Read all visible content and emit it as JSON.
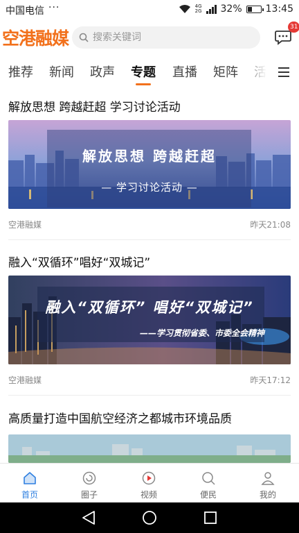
{
  "status_bar": {
    "carrier": "中国电信",
    "dots": "···",
    "network_top": "4G",
    "network_bottom": "2G",
    "battery_percent": "32%",
    "battery_level": 0.32,
    "time": "13:45"
  },
  "header": {
    "logo": "空港融媒",
    "search_placeholder": "搜索关键词",
    "message_badge": "31"
  },
  "tabs": {
    "items": [
      {
        "label": "推荐"
      },
      {
        "label": "新闻"
      },
      {
        "label": "政声"
      },
      {
        "label": "专题"
      },
      {
        "label": "直播"
      },
      {
        "label": "矩阵"
      },
      {
        "label": "活"
      }
    ],
    "active_index": 3
  },
  "articles": [
    {
      "title": "解放思想 跨越赶超 学习讨论活动",
      "banner_line1": "解放思想    跨越赶超",
      "banner_line2": "— 学习讨论活动 —",
      "source": "空港融媒",
      "time": "昨天21:08"
    },
    {
      "title": "融入“双循环”唱好“双城记”",
      "banner_line1": "融入“双循环” 唱好“双城记”",
      "banner_line2": "——学习贯彻省委、市委全会精神",
      "source": "空港融媒",
      "time": "昨天17:12"
    },
    {
      "title": "高质量打造中国航空经济之都城市环境品质"
    }
  ],
  "bottom_nav": [
    {
      "label": "首页",
      "icon": "home-icon"
    },
    {
      "label": "圈子",
      "icon": "circle-icon"
    },
    {
      "label": "视频",
      "icon": "video-icon"
    },
    {
      "label": "便民",
      "icon": "search-service-icon"
    },
    {
      "label": "我的",
      "icon": "person-icon"
    }
  ],
  "colors": {
    "accent": "#f2711c",
    "nav_active": "#2e7fe0",
    "badge": "#e53935"
  }
}
